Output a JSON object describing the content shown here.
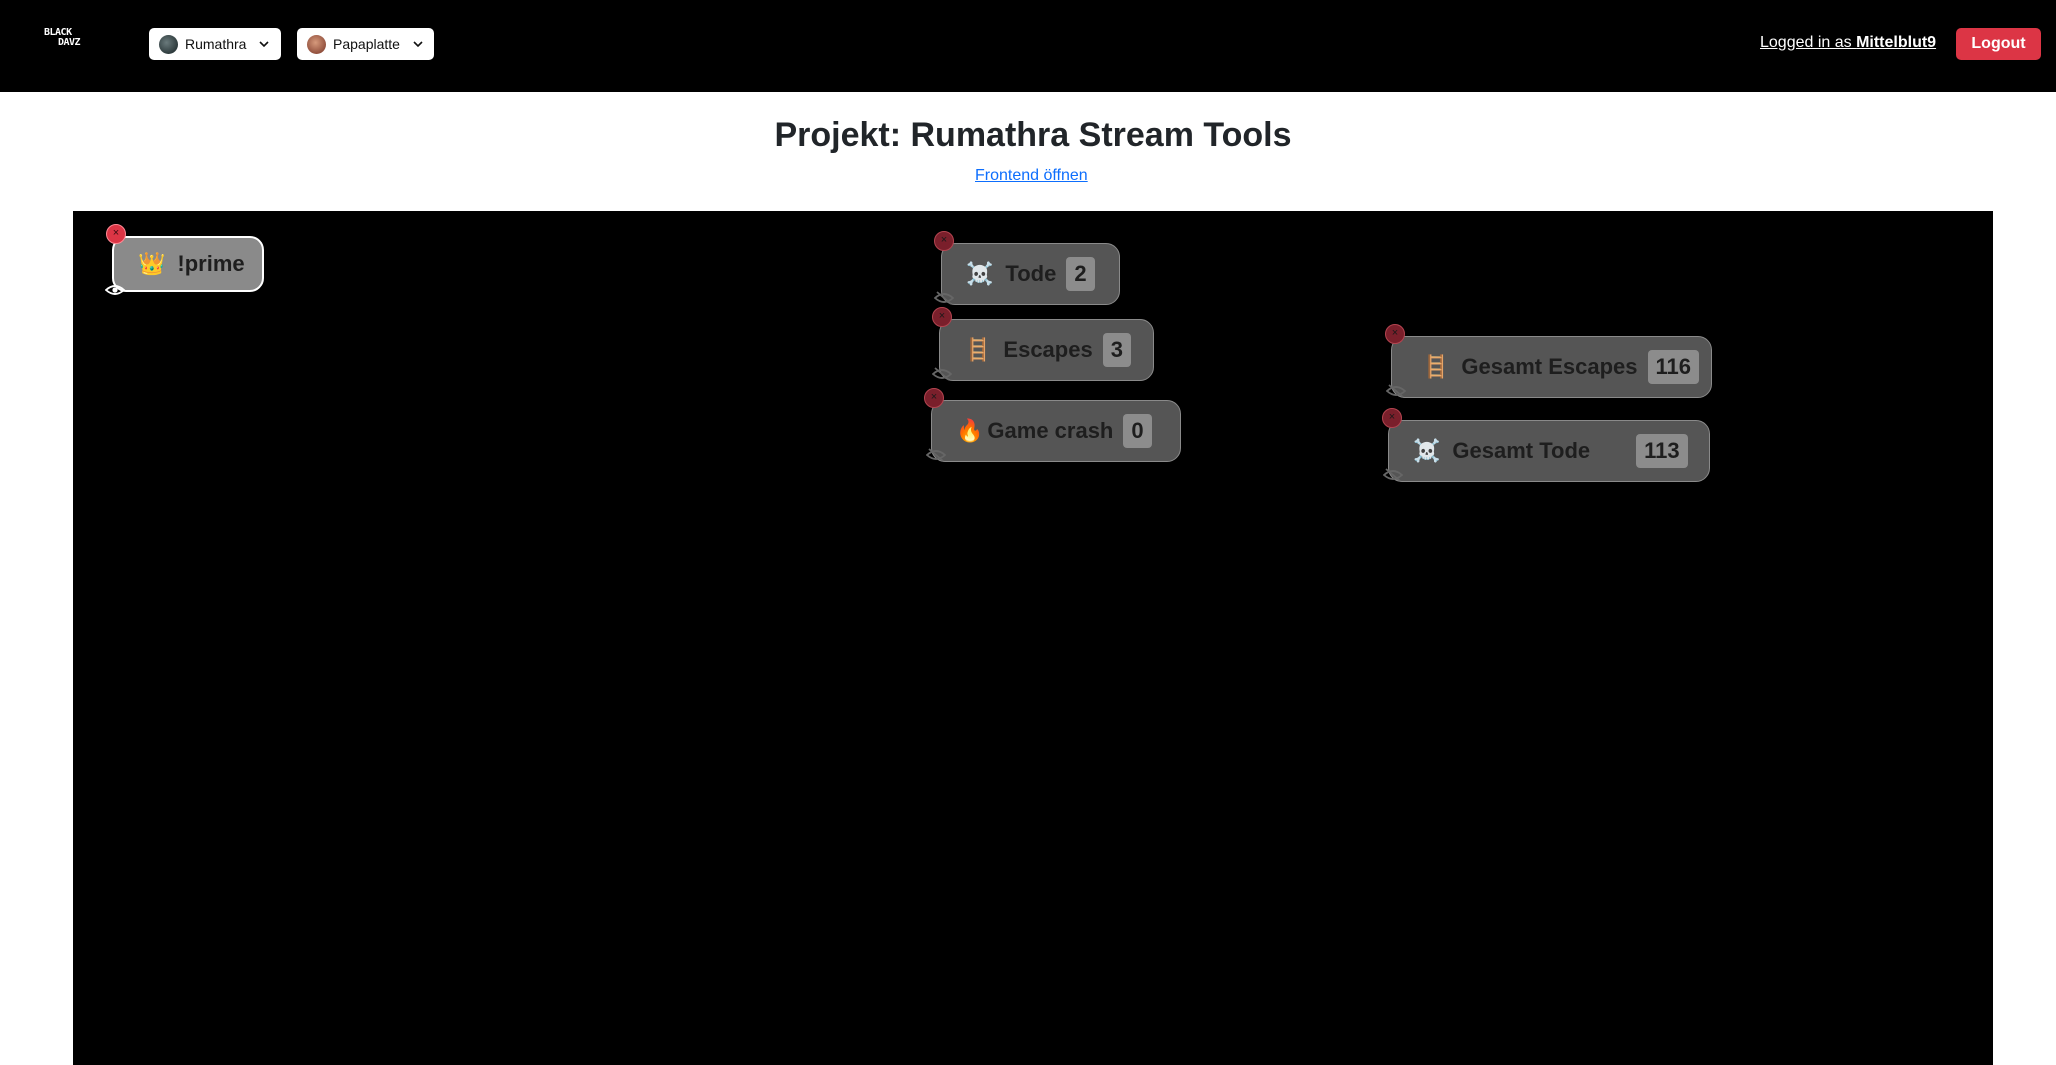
{
  "navbar": {
    "logo_line1": "BLACK",
    "logo_line2": "DAVZ",
    "channel_selectors": [
      {
        "label": "Rumathra"
      },
      {
        "label": "Papaplatte"
      }
    ],
    "logged_in_prefix": "Logged in as ",
    "username": "Mittelblut9",
    "logout_label": "Logout"
  },
  "page": {
    "title": "Projekt: Rumathra Stream Tools",
    "frontend_link": "Frontend öffnen"
  },
  "widgets": {
    "prime": {
      "emoji": "👑",
      "label": "!prime"
    },
    "tode": {
      "emoji": "☠️",
      "label": "Tode",
      "value": "2"
    },
    "escapes": {
      "emoji": "🪜",
      "label": "Escapes",
      "value": "3"
    },
    "game_crash": {
      "emoji": "🔥",
      "label": "Game crash",
      "value": "0"
    },
    "gesamt_escapes": {
      "emoji": "🪜",
      "label": "Gesamt Escapes",
      "value": "116"
    },
    "gesamt_tode": {
      "emoji": "☠️",
      "label": "Gesamt Tode",
      "value": "113"
    }
  },
  "widget_controls": {
    "delete_glyph": "×"
  },
  "colors": {
    "navbar_bg": "#000000",
    "logout_bg": "#dc3545",
    "link": "#0d6efd",
    "stage_bg": "#000000",
    "widget_bg": "#555555"
  },
  "icons": [
    "chevron-down-icon",
    "eye-icon",
    "eye-slash-icon",
    "delete-icon"
  ]
}
